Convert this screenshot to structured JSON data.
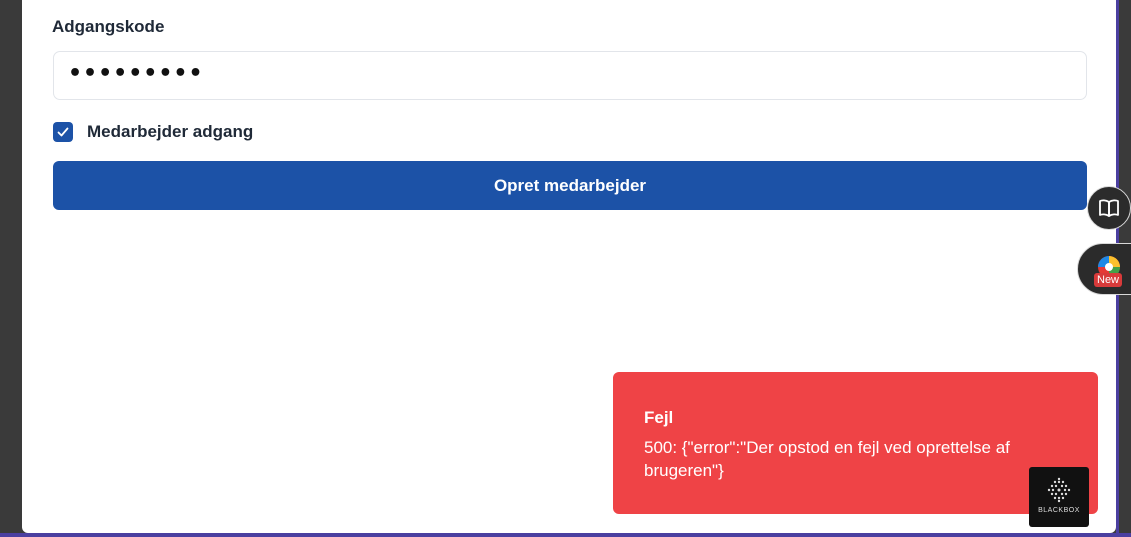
{
  "form": {
    "password_label": "Adgangskode",
    "password_value": "•••••••••",
    "employee_access_label": "Medarbejder adgang",
    "employee_access_checked": true,
    "submit_label": "Opret medarbejder"
  },
  "side_widgets": {
    "book_icon": "book-icon",
    "new_widget_icon": "colorful-widget-icon",
    "new_badge": "New"
  },
  "toast": {
    "title": "Fejl",
    "message": "500: {\"error\":\"Der opstod en fejl ved oprettelse af brugeren\"}"
  },
  "watermark": {
    "text": "BLACKBOX"
  },
  "colors": {
    "primary": "#1c52a7",
    "error": "#ef4346",
    "frame": "#4b3fa0"
  }
}
